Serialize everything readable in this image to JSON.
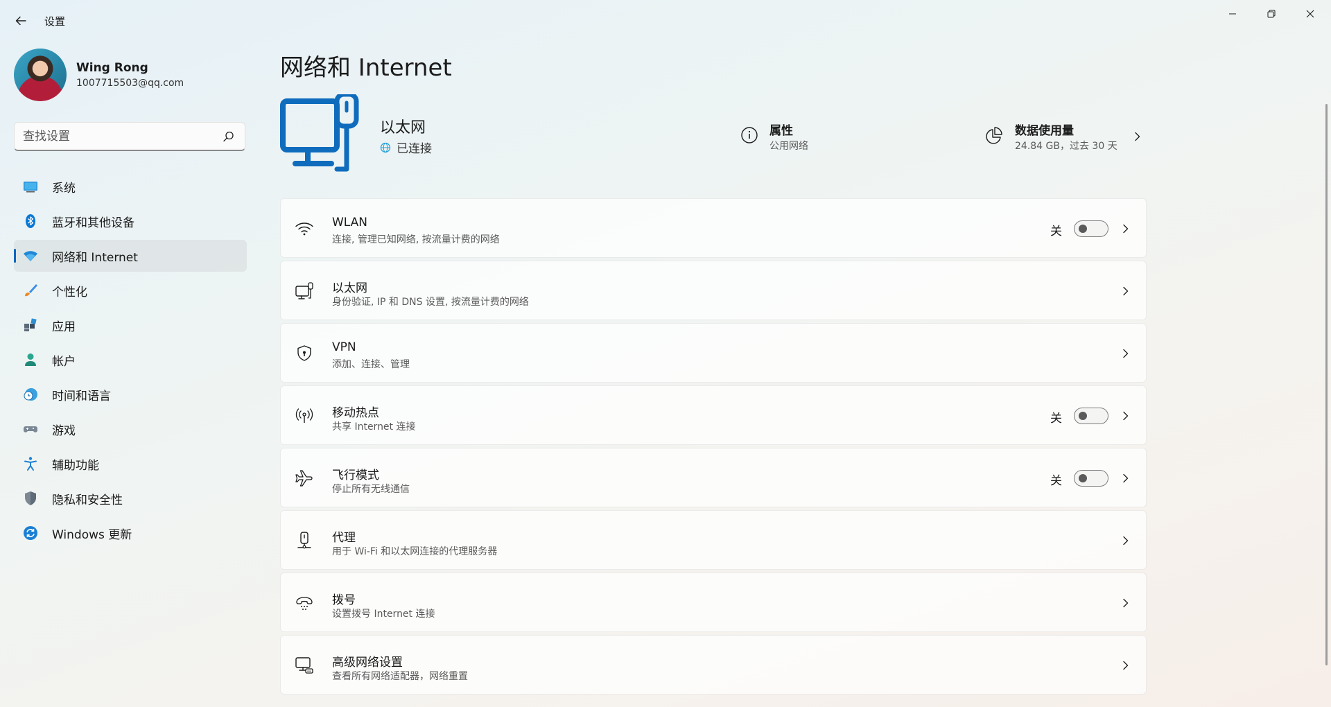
{
  "window": {
    "title": "设置"
  },
  "profile": {
    "name": "Wing Rong",
    "email": "1007715503@qq.com"
  },
  "search": {
    "placeholder": "查找设置"
  },
  "sidebar": {
    "items": [
      {
        "label": "系统",
        "icon": "system-icon"
      },
      {
        "label": "蓝牙和其他设备",
        "icon": "bluetooth-icon"
      },
      {
        "label": "网络和 Internet",
        "icon": "wifi-network-icon",
        "active": true
      },
      {
        "label": "个性化",
        "icon": "paintbrush-icon"
      },
      {
        "label": "应用",
        "icon": "apps-icon"
      },
      {
        "label": "帐户",
        "icon": "account-icon"
      },
      {
        "label": "时间和语言",
        "icon": "time-language-icon"
      },
      {
        "label": "游戏",
        "icon": "gamepad-icon"
      },
      {
        "label": "辅助功能",
        "icon": "accessibility-icon"
      },
      {
        "label": "隐私和安全性",
        "icon": "shield-icon"
      },
      {
        "label": "Windows 更新",
        "icon": "windows-update-icon"
      }
    ]
  },
  "main": {
    "title": "网络和 Internet",
    "hero": {
      "title": "以太网",
      "status": "已连接",
      "properties": {
        "title": "属性",
        "subtitle": "公用网络"
      },
      "data_usage": {
        "title": "数据使用量",
        "subtitle": "24.84 GB，过去 30 天"
      }
    },
    "cards": [
      {
        "title": "WLAN",
        "subtitle": "连接, 管理已知网络, 按流量计费的网络",
        "icon": "wifi-icon",
        "state": "关",
        "toggle_on": false
      },
      {
        "title": "以太网",
        "subtitle": "身份验证, IP 和 DNS 设置, 按流量计费的网络",
        "icon": "ethernet-icon"
      },
      {
        "title": "VPN",
        "subtitle": "添加、连接、管理",
        "icon": "vpn-shield-icon"
      },
      {
        "title": "移动热点",
        "subtitle": "共享 Internet 连接",
        "icon": "hotspot-icon",
        "state": "关",
        "toggle_on": false
      },
      {
        "title": "飞行模式",
        "subtitle": "停止所有无线通信",
        "icon": "airplane-icon",
        "state": "关",
        "toggle_on": false
      },
      {
        "title": "代理",
        "subtitle": "用于 Wi-Fi 和以太网连接的代理服务器",
        "icon": "proxy-icon"
      },
      {
        "title": "拨号",
        "subtitle": "设置拨号 Internet 连接",
        "icon": "dialup-icon"
      },
      {
        "title": "高级网络设置",
        "subtitle": "查看所有网络适配器，网络重置",
        "icon": "advanced-network-icon"
      }
    ]
  },
  "colors": {
    "accent": "#0067c0",
    "hero_icon": "#0f6cbd"
  }
}
